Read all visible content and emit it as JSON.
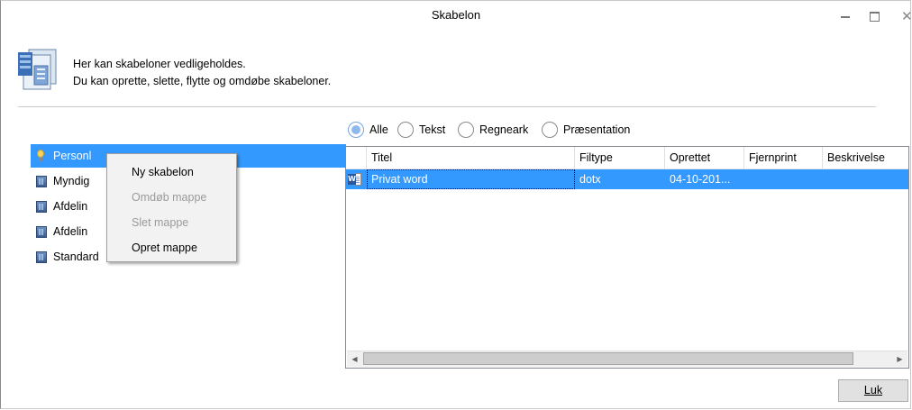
{
  "window": {
    "title": "Skabelon",
    "minimize_label": "–",
    "close_label": "✕"
  },
  "header": {
    "line1": "Her kan skabeloner vedligeholdes.",
    "line2": "Du kan oprette, slette, flytte og omdøbe skabeloner."
  },
  "filters": {
    "selected": "Alle",
    "options": [
      "Alle",
      "Tekst",
      "Regneark",
      "Præsentation"
    ]
  },
  "tree": {
    "items": [
      {
        "label": "Personlig",
        "icon": "bulb-icon",
        "selected": true
      },
      {
        "label": "Myndighed",
        "icon": "building-icon"
      },
      {
        "label": "Afdeling",
        "icon": "building-icon"
      },
      {
        "label": "Afdeling",
        "icon": "building-icon"
      },
      {
        "label": "Standard",
        "icon": "building-icon"
      }
    ],
    "visible_labels": [
      "Personl",
      "Myndig",
      "Afdelin",
      "Afdelin",
      "Standard"
    ]
  },
  "context_menu": {
    "items": [
      {
        "label": "Ny skabelon",
        "enabled": true
      },
      {
        "label": "Omdøb mappe",
        "enabled": false
      },
      {
        "label": "Slet mappe",
        "enabled": false
      },
      {
        "label": "Opret mappe",
        "enabled": true
      }
    ]
  },
  "grid": {
    "columns": [
      "Titel",
      "Filtype",
      "Oprettet",
      "Fjernprint",
      "Beskrivelse"
    ],
    "rows": [
      {
        "icon": "word-document-icon",
        "title": "Privat word",
        "filetype": "dotx",
        "created": "04-10-201...",
        "remote_print": "",
        "description": "",
        "selected": true
      }
    ]
  },
  "buttons": {
    "close": "Luk"
  },
  "colors": {
    "selection": "#3399ff",
    "radio_selected": "#8fb9ec"
  }
}
